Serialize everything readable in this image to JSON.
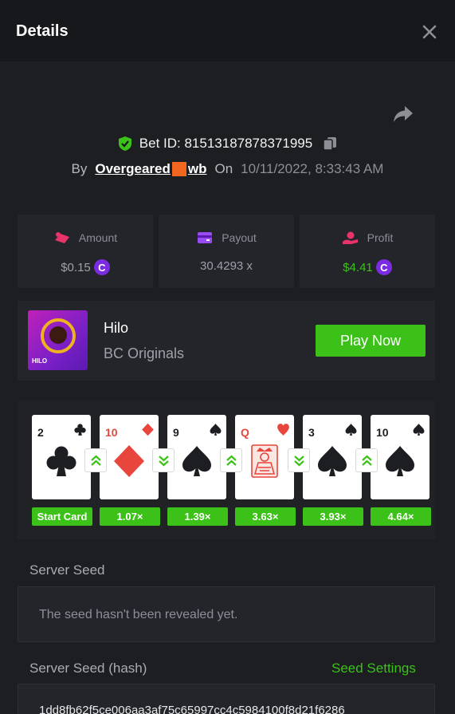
{
  "header": {
    "title": "Details"
  },
  "bet": {
    "id_text": "Bet ID: 81513187878371995",
    "by_label": "By",
    "user_first": "Overgeared",
    "user_second": "wb",
    "on_label": "On",
    "date": "10/11/2022, 8:33:43 AM"
  },
  "stats": {
    "amount_label": "Amount",
    "amount_value": "$0.15",
    "payout_label": "Payout",
    "payout_value": "30.4293 x",
    "profit_label": "Profit",
    "profit_value": "$4.41"
  },
  "coin_symbol": "C",
  "game": {
    "name": "Hilo",
    "provider": "BC Originals",
    "thumb_text": "HILO",
    "play_label": "Play Now"
  },
  "cards": [
    {
      "rank": "2",
      "suit": "club",
      "badge": "Start Card",
      "color": "#1c1e22"
    },
    {
      "rank": "10",
      "suit": "diamond",
      "badge": "1.07×",
      "color": "#e8453c"
    },
    {
      "rank": "9",
      "suit": "spade",
      "badge": "1.39×",
      "color": "#1c1e22"
    },
    {
      "rank": "Q",
      "suit": "heart",
      "badge": "3.63×",
      "color": "#e8453c"
    },
    {
      "rank": "3",
      "suit": "spade",
      "badge": "3.93×",
      "color": "#1c1e22"
    },
    {
      "rank": "10",
      "suit": "spade",
      "badge": "4.64×",
      "color": "#1c1e22"
    }
  ],
  "guesses": [
    "higher",
    "lower",
    "higher",
    "lower",
    "higher"
  ],
  "colors": {
    "accent": "#3bc117",
    "coin": "#7b2ce0",
    "panel": "#23252a",
    "background": "#1c1e22"
  },
  "server_seed": {
    "label": "Server Seed",
    "value": "The seed hasn't been revealed yet."
  },
  "server_seed_hash": {
    "label": "Server Seed (hash)",
    "settings_label": "Seed Settings",
    "value": "1dd8fb62f5ce006aa3af75c65997cc4c5984100f8d21f6286"
  }
}
